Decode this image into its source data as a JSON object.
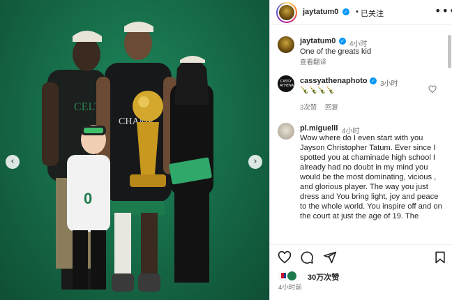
{
  "header": {
    "username": "jaytatum0",
    "follow_status": "已关注",
    "separator": "•",
    "more": "•••"
  },
  "photo": {
    "prev_icon": "chevron-left-icon",
    "next_icon": "chevron-right-icon"
  },
  "comments": [
    {
      "username": "jaytatum0",
      "verified": true,
      "time": "4小时",
      "text": "One of the greats kid",
      "translate": "查看翻译"
    },
    {
      "username": "cassyathenaphoto",
      "verified": true,
      "time": "3小时",
      "text": "🍾🍾🍾🍾",
      "likes": "3次赞",
      "reply": "回复"
    },
    {
      "username": "pl.miguelll",
      "verified": false,
      "time": "4小时",
      "text": "Wow where do I even start with you Jayson Christopher Tatum. Ever since I spotted you at chaminade high school I already had no doubt in my mind you would be the most dominating, vicious , and glorious player. The way you just dress and You bring light, joy and peace to the whole world. You inspire off and on the court at just the age of 19. The"
    }
  ],
  "actions": {
    "likes": "30万次赞",
    "post_time": "4小时前"
  },
  "colors": {
    "verified": "#0095f6",
    "photo_bg": "#176e4a",
    "text": "#262626",
    "muted": "#737373"
  }
}
